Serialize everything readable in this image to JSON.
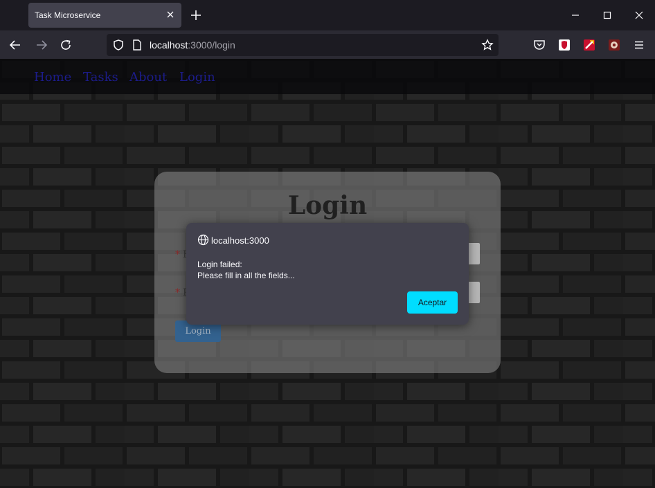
{
  "browser": {
    "tab_title": "Task Microservice",
    "url_host": "localhost",
    "url_rest": ":3000/login"
  },
  "site": {
    "nav": [
      "Home",
      "Tasks",
      "About",
      "Login"
    ]
  },
  "login": {
    "title": "Login",
    "required_mark": "*",
    "email_label_partial": "E",
    "password_label_partial": "P",
    "button_label": "Login"
  },
  "dialog": {
    "origin": "localhost:3000",
    "line1": "Login failed:",
    "line2": "Please fill in all the fields...",
    "button_label": "Aceptar"
  },
  "colors": {
    "accent": "#00ddff",
    "toolbar": "#2b2a33",
    "titlebar": "#1c1b22"
  }
}
